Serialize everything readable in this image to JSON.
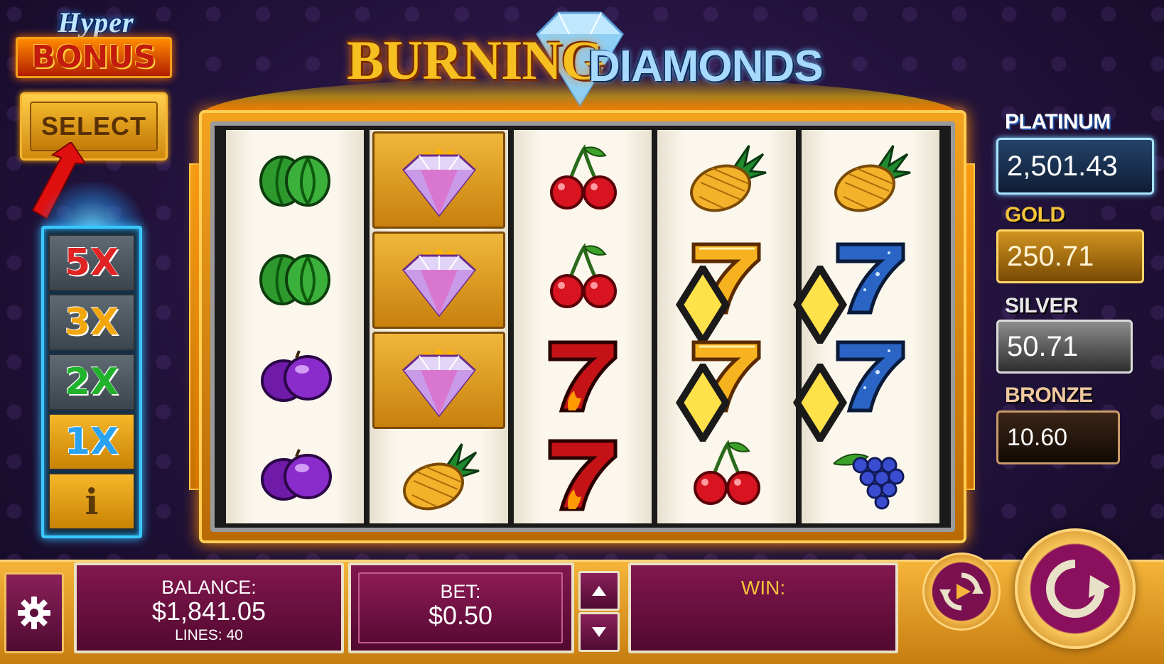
{
  "hyper_bonus": {
    "hyper_text": "Hyper",
    "bonus_text": "BONUS",
    "select_label": "SELECT"
  },
  "multipliers": [
    {
      "label": "5X",
      "active": false
    },
    {
      "label": "3X",
      "active": false
    },
    {
      "label": "2X",
      "active": false
    },
    {
      "label": "1X",
      "active": true
    },
    {
      "label": "i",
      "active": true
    }
  ],
  "game_title": {
    "part1": "BURNING",
    "part2": "DIAMONDS"
  },
  "reels": [
    [
      "watermelon",
      "watermelon",
      "plum",
      "plum"
    ],
    [
      "burning-diamond",
      "burning-diamond",
      "burning-diamond",
      "pineapple"
    ],
    [
      "cherry",
      "cherry",
      "red-seven",
      "red-seven"
    ],
    [
      "pineapple",
      "gold-seven",
      "gold-seven",
      "cherry"
    ],
    [
      "pineapple",
      "blue-seven",
      "blue-seven",
      "grapes"
    ]
  ],
  "jackpots": {
    "platinum": {
      "label": "PLATINUM",
      "value": "2,501.43"
    },
    "gold": {
      "label": "GOLD",
      "value": "250.71"
    },
    "silver": {
      "label": "SILVER",
      "value": "50.71"
    },
    "bronze": {
      "label": "BRONZE",
      "value": "10.60"
    }
  },
  "bottom": {
    "balance_label": "BALANCE:",
    "balance_value": "$1,841.05",
    "lines_label": "LINES: 40",
    "bet_label": "BET:",
    "bet_value": "$0.50",
    "win_label": "WIN:",
    "win_value": ""
  },
  "icons": {
    "settings": "gear-icon",
    "bet_up": "arrow-up-icon",
    "bet_down": "arrow-down-icon",
    "autoplay": "autoplay-icon",
    "spin": "spin-icon"
  },
  "colors": {
    "frame_gold": "#f3a31f",
    "panel_magenta": "#82174f",
    "multiplier_blue": "#39c9ff"
  }
}
